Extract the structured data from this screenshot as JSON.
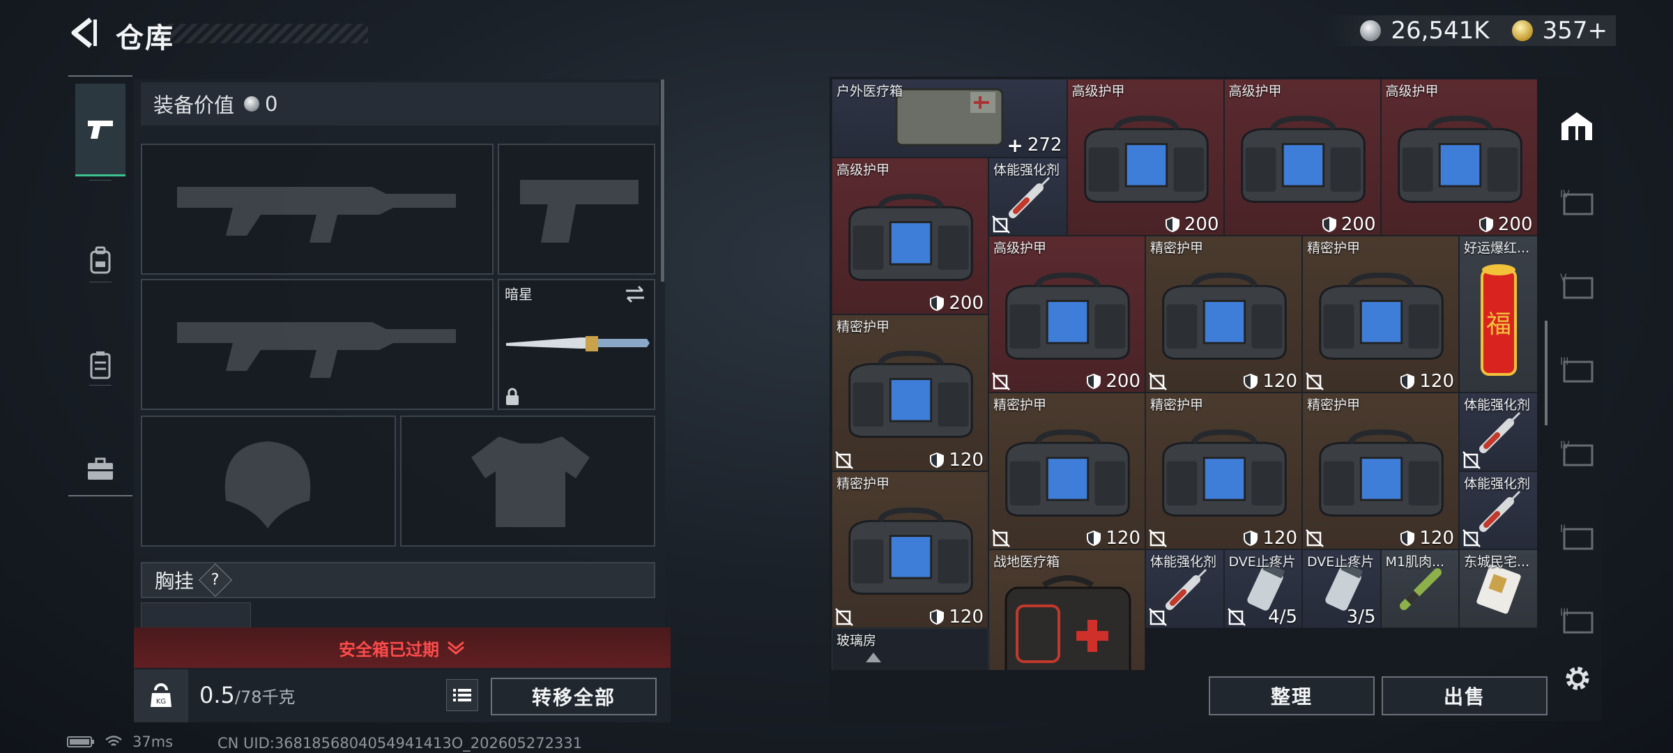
{
  "header": {
    "title": "仓库",
    "currency_silver": "26,541K",
    "currency_gold": "357+"
  },
  "left_nav": {
    "items": [
      "weapons",
      "backpack",
      "vest",
      "case"
    ],
    "active": "weapons"
  },
  "equipment": {
    "value_label": "装备价值",
    "value": "0",
    "slot_knife_name": "暗星",
    "chest_label": "胸挂",
    "chest_help": "?"
  },
  "safe_box": {
    "status": "安全箱已过期"
  },
  "weight": {
    "current": "0.5",
    "capacity": "/78千克"
  },
  "buttons": {
    "transfer_all": "转移全部",
    "organize": "整理",
    "sell": "出售"
  },
  "status_bar": {
    "ping": "37ms",
    "uid": "CN UID:3681856804054941413O_202605272331"
  },
  "grid_items": [
    {
      "name": "户外医疗箱",
      "value": "272",
      "kind": "med"
    },
    {
      "name": "高级护甲",
      "value": "200",
      "kind": "armor"
    },
    {
      "name": "高级护甲",
      "value": "200",
      "kind": "armor"
    },
    {
      "name": "高级护甲",
      "value": "200",
      "kind": "armor"
    },
    {
      "name": "高级护甲",
      "value": "200",
      "kind": "armor"
    },
    {
      "name": "体能强化剂",
      "value": "",
      "kind": "syringe"
    },
    {
      "name": "高级护甲",
      "value": "200",
      "kind": "armor"
    },
    {
      "name": "精密护甲",
      "value": "120",
      "kind": "armor"
    },
    {
      "name": "精密护甲",
      "value": "120",
      "kind": "armor"
    },
    {
      "name": "好运爆红...",
      "value": "",
      "kind": "firecracker"
    },
    {
      "name": "精密护甲",
      "value": "120",
      "kind": "armor"
    },
    {
      "name": "精密护甲",
      "value": "120",
      "kind": "armor"
    },
    {
      "name": "精密护甲",
      "value": "120",
      "kind": "armor"
    },
    {
      "name": "精密护甲",
      "value": "120",
      "kind": "armor"
    },
    {
      "name": "体能强化剂",
      "value": "",
      "kind": "syringe"
    },
    {
      "name": "精密护甲",
      "value": "120",
      "kind": "armor"
    },
    {
      "name": "体能强化剂",
      "value": "",
      "kind": "syringe"
    },
    {
      "name": "战地医疗箱",
      "value": "",
      "kind": "medkit"
    },
    {
      "name": "体能强化剂",
      "value": "",
      "kind": "syringe"
    },
    {
      "name": "DVE止疼片",
      "value": "4/5",
      "kind": "pills"
    },
    {
      "name": "DVE止疼片",
      "value": "3/5",
      "kind": "pills"
    },
    {
      "name": "M1肌肉...",
      "value": "",
      "kind": "injector"
    },
    {
      "name": "东城民宅...",
      "value": "",
      "kind": "key"
    },
    {
      "name": "玻璃房",
      "value": "",
      "kind": "key"
    }
  ],
  "colors": {
    "accent": "#3cc28f",
    "warning": "#ff4b4b",
    "armor_red": "#5a2a2f",
    "armor_brown": "#4a3a2e"
  }
}
